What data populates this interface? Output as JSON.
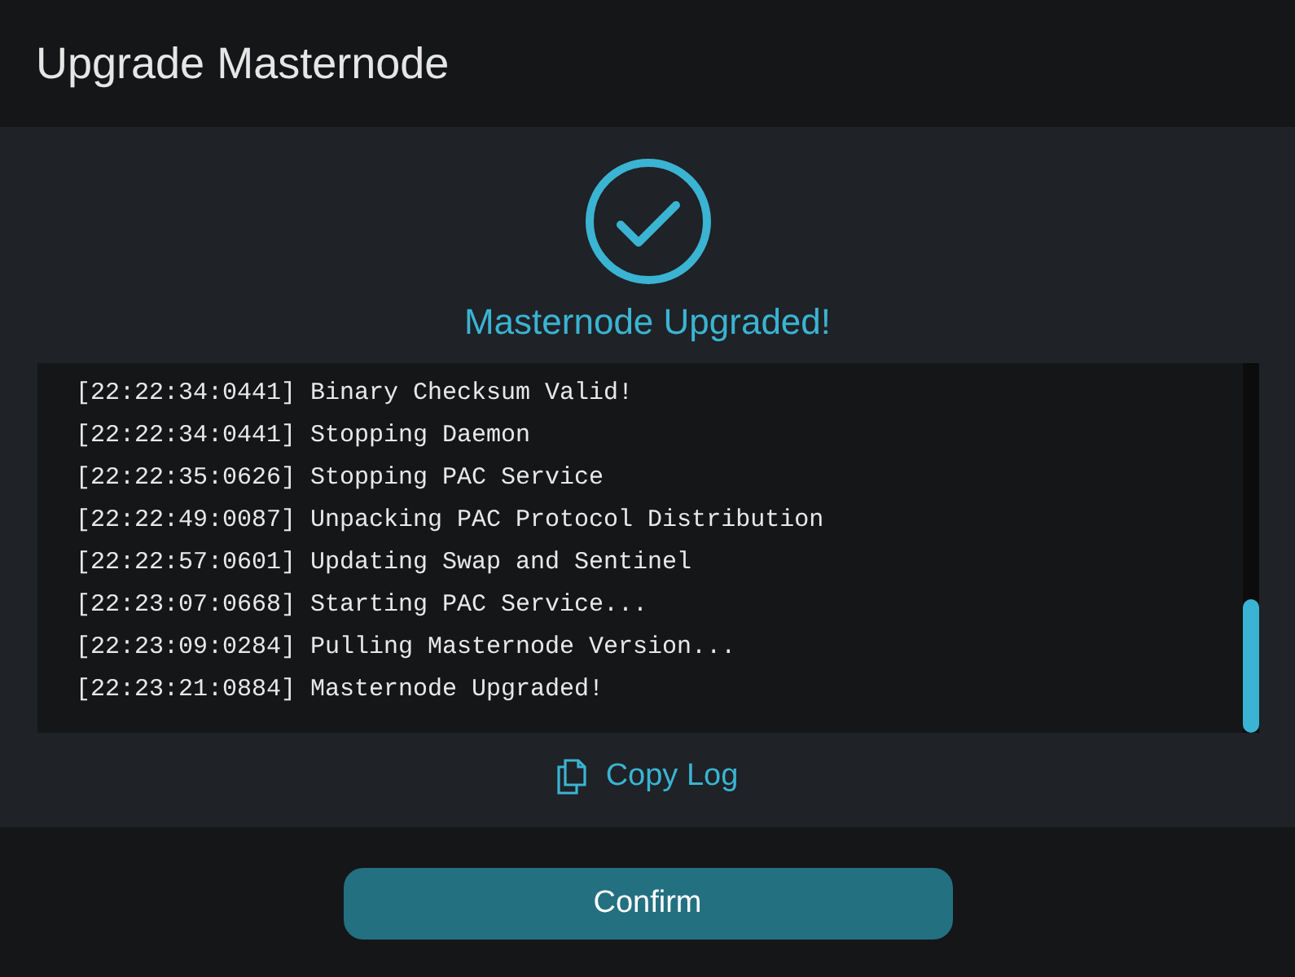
{
  "window": {
    "title": "Upgrade Masternode"
  },
  "status": {
    "kind": "success",
    "message": "Masternode Upgraded!"
  },
  "log": [
    {
      "time": "[22:22:34:0441]",
      "text": "Binary Checksum Valid!"
    },
    {
      "time": "[22:22:34:0441]",
      "text": "Stopping Daemon"
    },
    {
      "time": "[22:22:35:0626]",
      "text": "Stopping PAC Service"
    },
    {
      "time": "[22:22:49:0087]",
      "text": "Unpacking PAC Protocol Distribution"
    },
    {
      "time": "[22:22:57:0601]",
      "text": "Updating Swap and Sentinel"
    },
    {
      "time": "[22:23:07:0668]",
      "text": "Starting PAC Service..."
    },
    {
      "time": "[22:23:09:0284]",
      "text": "Pulling Masternode Version..."
    },
    {
      "time": "[22:23:21:0884]",
      "text": "Masternode Upgraded!"
    }
  ],
  "copy_link": "Copy Log",
  "buttons": [
    "Confirm"
  ]
}
